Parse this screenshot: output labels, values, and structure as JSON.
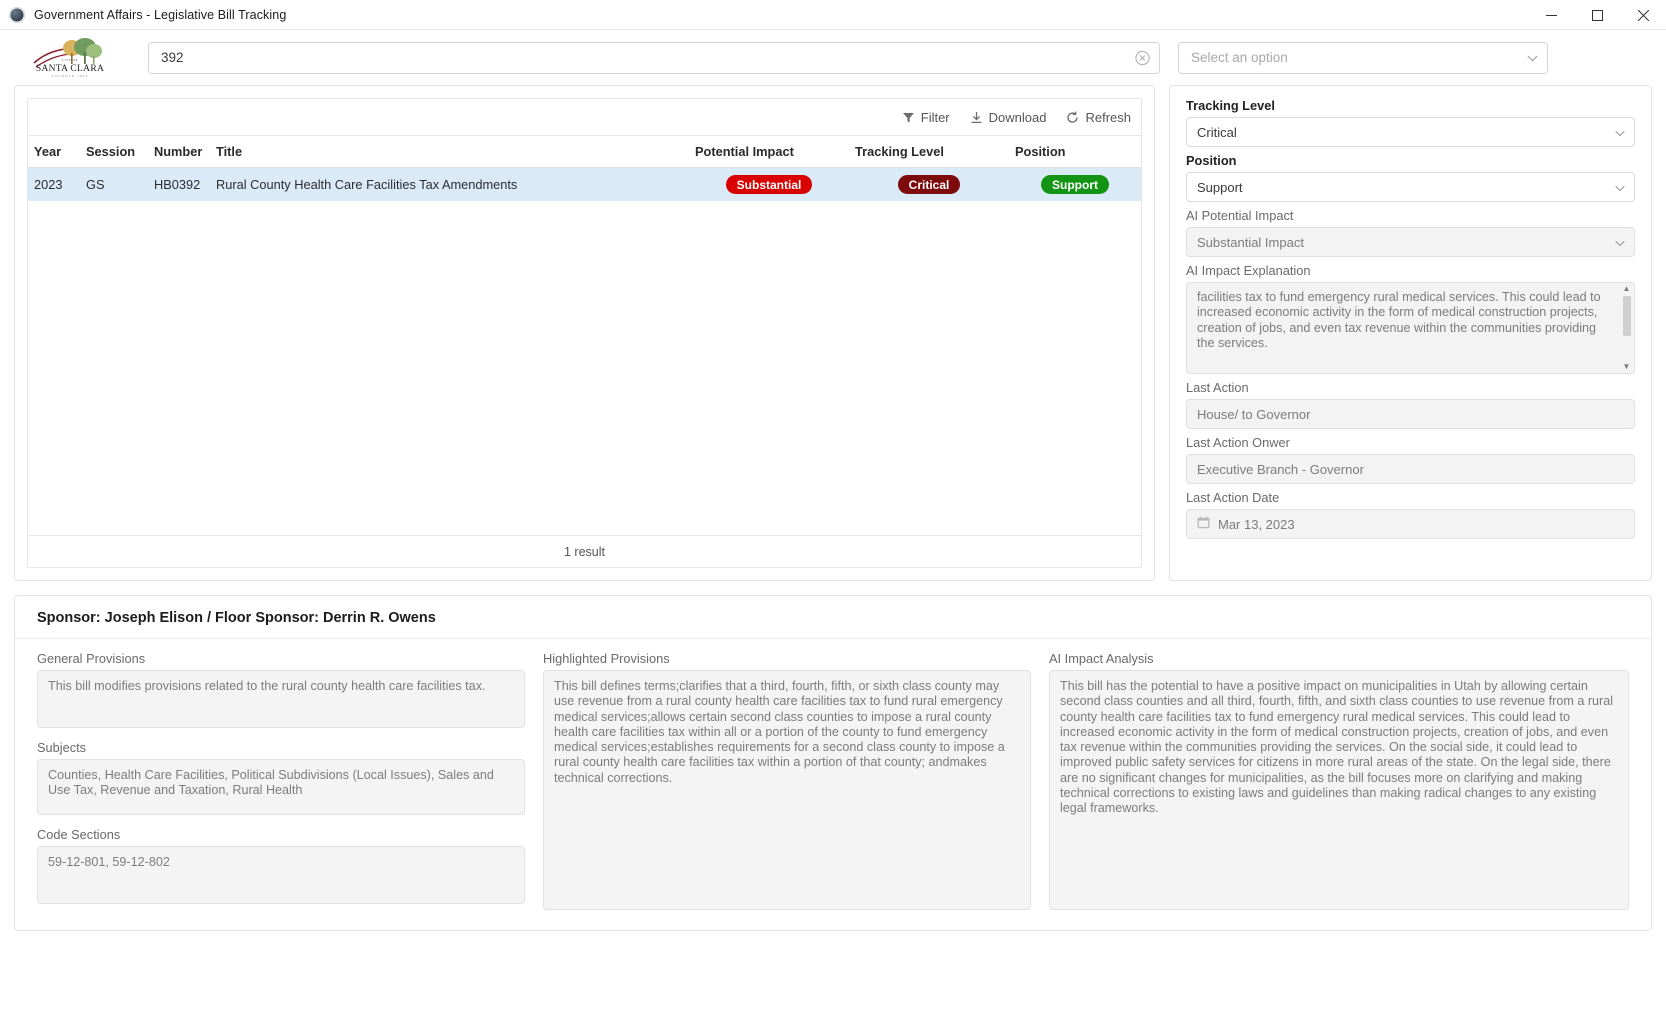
{
  "window": {
    "title": "Government Affairs - Legislative Bill Tracking",
    "app_icon": "app-globe-icon",
    "controls": {
      "minimize": "minimize-icon",
      "maximize": "maximize-icon",
      "close": "close-icon"
    }
  },
  "topbar": {
    "logo_primary": "SANTA CLARA",
    "logo_secondary": "CITY OF",
    "logo_tertiary": "FOUNDED 1854",
    "search": {
      "value": "392",
      "placeholder": "",
      "clear_icon": "clear-circle-icon"
    },
    "option_select": {
      "placeholder": "Select an option",
      "value": ""
    }
  },
  "grid": {
    "toolbar": {
      "filter_label": "Filter",
      "download_label": "Download",
      "refresh_label": "Refresh"
    },
    "columns": [
      "Year",
      "Session",
      "Number",
      "Title",
      "Potential Impact",
      "Tracking Level",
      "Position"
    ],
    "rows": [
      {
        "year": "2023",
        "session": "GS",
        "number": "HB0392",
        "title": "Rural County Health Care Facilities Tax Amendments",
        "potential_impact": "Substantial",
        "tracking_level": "Critical",
        "position": "Support"
      }
    ],
    "footer": "1 result"
  },
  "colors": {
    "badge_substantial": "#d80000",
    "badge_critical": "#7d0b0b",
    "badge_support": "#149414",
    "row_selected": "#dbeaf7"
  },
  "details": {
    "tracking_level_label": "Tracking Level",
    "tracking_level_value": "Critical",
    "position_label": "Position",
    "position_value": "Support",
    "ai_potential_impact_label": "AI Potential Impact",
    "ai_potential_impact_value": "Substantial Impact",
    "ai_impact_explanation_label": "AI Impact Explanation",
    "ai_impact_explanation_value": "facilities tax to fund emergency rural medical services. This could lead to increased economic activity in the form of medical construction projects, creation of jobs, and even tax revenue within the communities providing the services.",
    "last_action_label": "Last Action",
    "last_action_value": "House/ to Governor",
    "last_action_owner_label": "Last Action Onwer",
    "last_action_owner_value": "Executive Branch - Governor",
    "last_action_date_label": "Last Action Date",
    "last_action_date_value": "Mar 13, 2023",
    "calendar_icon": "calendar-icon"
  },
  "bottom": {
    "sponsor_heading": "Sponsor: Joseph Elison / Floor Sponsor: Derrin R. Owens",
    "general_provisions_label": "General Provisions",
    "general_provisions_value": "This bill modifies provisions related to the rural county health care facilities tax.",
    "subjects_label": "Subjects",
    "subjects_value": "Counties, Health Care Facilities, Political Subdivisions (Local Issues), Sales and Use Tax, Revenue and Taxation, Rural Health",
    "code_sections_label": "Code Sections",
    "code_sections_value": "59-12-801, 59-12-802",
    "highlighted_provisions_label": "Highlighted Provisions",
    "highlighted_provisions_value": "This bill defines terms;clarifies that a third, fourth, fifth, or sixth class county may use revenue from a rural county health care facilities tax to fund rural emergency medical services;allows certain second class counties to impose a rural county health care facilities tax within all or a portion of the county to fund emergency medical services;establishes requirements for a second class county to impose a rural county health care facilities tax within a portion of that county; andmakes technical corrections.",
    "ai_impact_analysis_label": "AI Impact Analysis",
    "ai_impact_analysis_value": "This bill has the potential to have a positive impact on municipalities in Utah by allowing certain second class counties and all third, fourth, fifth, and sixth class counties to use revenue from a rural county health care facilities tax to fund emergency rural medical services. This could lead to increased economic activity in the form of medical construction projects, creation of jobs, and even tax revenue within the communities providing the services. On the social side, it could lead to improved public safety services for citizens in more rural areas of the state. On the legal side, there are no significant changes for municipalities, as the bill focuses more on clarifying and making technical corrections to existing laws and guidelines than making radical changes to any existing legal frameworks."
  }
}
